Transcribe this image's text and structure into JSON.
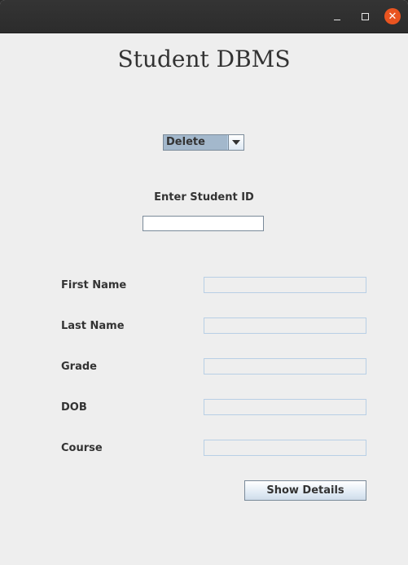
{
  "window": {
    "controls": {
      "minimize_icon": "minimize-icon",
      "maximize_icon": "maximize-icon",
      "close_icon": "close-icon",
      "close_glyph": "✕",
      "close_color": "#e95420"
    }
  },
  "app": {
    "title": "Student DBMS"
  },
  "operation_select": {
    "selected": "Delete",
    "arrow_icon": "chevron-down-icon"
  },
  "student_id": {
    "label": "Enter Student ID",
    "value": ""
  },
  "fields": [
    {
      "label": "First Name",
      "value": ""
    },
    {
      "label": "Last Name",
      "value": ""
    },
    {
      "label": "Grade",
      "value": ""
    },
    {
      "label": "DOB",
      "value": ""
    },
    {
      "label": "Course",
      "value": ""
    }
  ],
  "actions": {
    "show_details_label": "Show Details"
  },
  "colors": {
    "window_bg": "#eeeeee",
    "titlebar_bg": "#2c2c2c",
    "combo_selected_bg": "#a3b8cc",
    "field_border": "#b8cfe5"
  }
}
